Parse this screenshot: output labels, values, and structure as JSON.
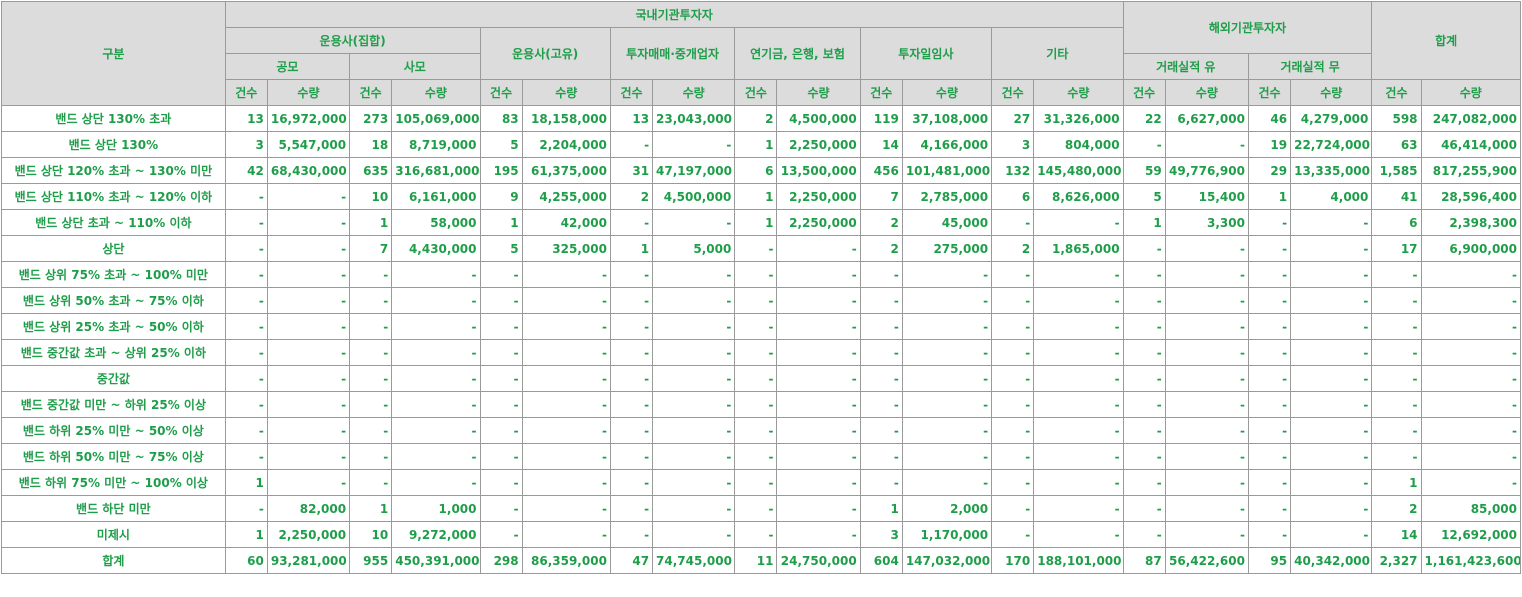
{
  "header": {
    "category": "구분",
    "domestic": "국내기관투자자",
    "foreign": "해외기관투자자",
    "total": "합계",
    "asset_mgmt_collective": "운용사(집합)",
    "asset_mgmt_proprietary": "운용사(고유)",
    "brokers": "투자매매·중개업자",
    "pension_bank_insurance": "연기금, 은행, 보험",
    "discretionary": "투자일임사",
    "other": "기타",
    "public_fund": "공모",
    "private_fund": "사모",
    "with_record": "거래실적 유",
    "without_record": "거래실적 무",
    "count": "건수",
    "quantity": "수량"
  },
  "rows": [
    {
      "label": "밴드 상단 130% 초과",
      "cells": [
        "13",
        "16,972,000",
        "273",
        "105,069,000",
        "83",
        "18,158,000",
        "13",
        "23,043,000",
        "2",
        "4,500,000",
        "119",
        "37,108,000",
        "27",
        "31,326,000",
        "22",
        "6,627,000",
        "46",
        "4,279,000",
        "598",
        "247,082,000"
      ]
    },
    {
      "label": "밴드 상단 130%",
      "cells": [
        "3",
        "5,547,000",
        "18",
        "8,719,000",
        "5",
        "2,204,000",
        "-",
        "-",
        "1",
        "2,250,000",
        "14",
        "4,166,000",
        "3",
        "804,000",
        "-",
        "-",
        "19",
        "22,724,000",
        "63",
        "46,414,000"
      ]
    },
    {
      "label": "밴드 상단 120% 초과 ~ 130% 미만",
      "cells": [
        "42",
        "68,430,000",
        "635",
        "316,681,000",
        "195",
        "61,375,000",
        "31",
        "47,197,000",
        "6",
        "13,500,000",
        "456",
        "101,481,000",
        "132",
        "145,480,000",
        "59",
        "49,776,900",
        "29",
        "13,335,000",
        "1,585",
        "817,255,900"
      ]
    },
    {
      "label": "밴드 상단 110% 초과 ~ 120% 이하",
      "cells": [
        "-",
        "-",
        "10",
        "6,161,000",
        "9",
        "4,255,000",
        "2",
        "4,500,000",
        "1",
        "2,250,000",
        "7",
        "2,785,000",
        "6",
        "8,626,000",
        "5",
        "15,400",
        "1",
        "4,000",
        "41",
        "28,596,400"
      ]
    },
    {
      "label": "밴드 상단 초과 ~ 110% 이하",
      "cells": [
        "-",
        "-",
        "1",
        "58,000",
        "1",
        "42,000",
        "-",
        "-",
        "1",
        "2,250,000",
        "2",
        "45,000",
        "-",
        "-",
        "1",
        "3,300",
        "-",
        "-",
        "6",
        "2,398,300"
      ]
    },
    {
      "label": "상단",
      "cells": [
        "-",
        "-",
        "7",
        "4,430,000",
        "5",
        "325,000",
        "1",
        "5,000",
        "-",
        "-",
        "2",
        "275,000",
        "2",
        "1,865,000",
        "-",
        "-",
        "-",
        "-",
        "17",
        "6,900,000"
      ]
    },
    {
      "label": "밴드 상위 75% 초과 ~ 100% 미만",
      "cells": [
        "-",
        "-",
        "-",
        "-",
        "-",
        "-",
        "-",
        "-",
        "-",
        "-",
        "-",
        "-",
        "-",
        "-",
        "-",
        "-",
        "-",
        "-",
        "-",
        "-"
      ]
    },
    {
      "label": "밴드 상위 50%  초과 ~ 75% 이하",
      "cells": [
        "-",
        "-",
        "-",
        "-",
        "-",
        "-",
        "-",
        "-",
        "-",
        "-",
        "-",
        "-",
        "-",
        "-",
        "-",
        "-",
        "-",
        "-",
        "-",
        "-"
      ]
    },
    {
      "label": "밴드 상위 25% 초과 ~ 50% 이하",
      "cells": [
        "-",
        "-",
        "-",
        "-",
        "-",
        "-",
        "-",
        "-",
        "-",
        "-",
        "-",
        "-",
        "-",
        "-",
        "-",
        "-",
        "-",
        "-",
        "-",
        "-"
      ]
    },
    {
      "label": "밴드 중간값 초과 ~ 상위 25% 이하",
      "cells": [
        "-",
        "-",
        "-",
        "-",
        "-",
        "-",
        "-",
        "-",
        "-",
        "-",
        "-",
        "-",
        "-",
        "-",
        "-",
        "-",
        "-",
        "-",
        "-",
        "-"
      ]
    },
    {
      "label": "중간값",
      "cells": [
        "-",
        "-",
        "-",
        "-",
        "-",
        "-",
        "-",
        "-",
        "-",
        "-",
        "-",
        "-",
        "-",
        "-",
        "-",
        "-",
        "-",
        "-",
        "-",
        "-"
      ]
    },
    {
      "label": "밴드 중간값 미만 ~ 하위 25% 이상",
      "cells": [
        "-",
        "-",
        "-",
        "-",
        "-",
        "-",
        "-",
        "-",
        "-",
        "-",
        "-",
        "-",
        "-",
        "-",
        "-",
        "-",
        "-",
        "-",
        "-",
        "-"
      ]
    },
    {
      "label": "밴드 하위 25% 미만 ~ 50% 이상",
      "cells": [
        "-",
        "-",
        "-",
        "-",
        "-",
        "-",
        "-",
        "-",
        "-",
        "-",
        "-",
        "-",
        "-",
        "-",
        "-",
        "-",
        "-",
        "-",
        "-",
        "-"
      ]
    },
    {
      "label": "밴드 하위 50% 미만 ~ 75% 이상",
      "cells": [
        "-",
        "-",
        "-",
        "-",
        "-",
        "-",
        "-",
        "-",
        "-",
        "-",
        "-",
        "-",
        "-",
        "-",
        "-",
        "-",
        "-",
        "-",
        "-",
        "-"
      ]
    },
    {
      "label": "밴드 하위 75% 미만 ~ 100% 이상",
      "cells": [
        "1",
        "-",
        "-",
        "-",
        "-",
        "-",
        "-",
        "-",
        "-",
        "-",
        "-",
        "-",
        "-",
        "-",
        "-",
        "-",
        "-",
        "-",
        "1",
        "-"
      ]
    },
    {
      "label": "밴드 하단 미만",
      "cells": [
        "-",
        "82,000",
        "1",
        "1,000",
        "-",
        "-",
        "-",
        "-",
        "-",
        "-",
        "1",
        "2,000",
        "-",
        "-",
        "-",
        "-",
        "-",
        "-",
        "2",
        "85,000"
      ]
    },
    {
      "label": "미제시",
      "cells": [
        "1",
        "2,250,000",
        "10",
        "9,272,000",
        "-",
        "-",
        "-",
        "-",
        "-",
        "-",
        "3",
        "1,170,000",
        "-",
        "-",
        "-",
        "-",
        "-",
        "-",
        "14",
        "12,692,000"
      ]
    },
    {
      "label": "합계",
      "cells": [
        "60",
        "93,281,000",
        "955",
        "450,391,000",
        "298",
        "86,359,000",
        "47",
        "74,745,000",
        "11",
        "24,750,000",
        "604",
        "147,032,000",
        "170",
        "188,101,000",
        "87",
        "56,422,600",
        "95",
        "40,342,000",
        "2,327",
        "1,161,423,600"
      ]
    }
  ]
}
